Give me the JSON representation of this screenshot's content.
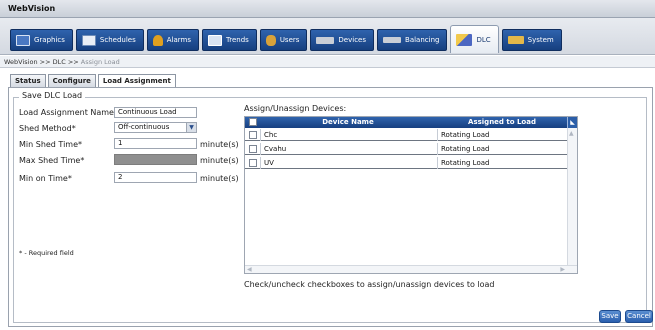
{
  "app": {
    "title": "WebVision"
  },
  "tabs": [
    {
      "label": "Graphics",
      "icon": "graphics-icon",
      "color": "#4a78c2"
    },
    {
      "label": "Schedules",
      "icon": "schedules-icon",
      "color": "#6f8db8"
    },
    {
      "label": "Alarms",
      "icon": "alarms-icon",
      "color": "#e0a020"
    },
    {
      "label": "Trends",
      "icon": "trends-icon",
      "color": "#d9e3f2"
    },
    {
      "label": "Users",
      "icon": "users-icon",
      "color": "#d8a23a"
    },
    {
      "label": "Devices",
      "icon": "devices-icon",
      "color": "#c9ced6"
    },
    {
      "label": "Balancing",
      "icon": "balancing-icon",
      "color": "#c9ced6"
    },
    {
      "label": "DLC",
      "icon": "dlc-icon",
      "color": "#4c67c2"
    },
    {
      "label": "System",
      "icon": "system-icon",
      "color": "#e3b84a"
    }
  ],
  "breadcrumb": {
    "path": "WebVision >> DLC >> ",
    "current": "Assign Load"
  },
  "subtabs": [
    "Status",
    "Configure",
    "Load Assignment"
  ],
  "form": {
    "legend": "Save DLC Load",
    "load_name_label": "Load Assignment Name*",
    "load_name_value": "Continuous Load",
    "shed_method_label": "Shed Method*",
    "shed_method_value": "Off-continuous",
    "min_shed_label": "Min Shed Time*",
    "min_shed_value": "1",
    "max_shed_label": "Max Shed Time*",
    "min_on_label": "Min on Time*",
    "min_on_value": "2",
    "unit": "minute(s)",
    "required_note": "* - Required field"
  },
  "assign": {
    "title": "Assign/Unassign Devices:",
    "col_device": "Device Name",
    "col_assigned": "Assigned to Load",
    "rows": [
      {
        "device": "Chc",
        "assigned": "Rotating Load"
      },
      {
        "device": "Cvahu",
        "assigned": "Rotating Load"
      },
      {
        "device": "UV",
        "assigned": "Rotating Load"
      }
    ],
    "hint": "Check/uncheck checkboxes to assign/unassign devices to load"
  },
  "actions": {
    "save": "Save",
    "cancel": "Cancel"
  }
}
